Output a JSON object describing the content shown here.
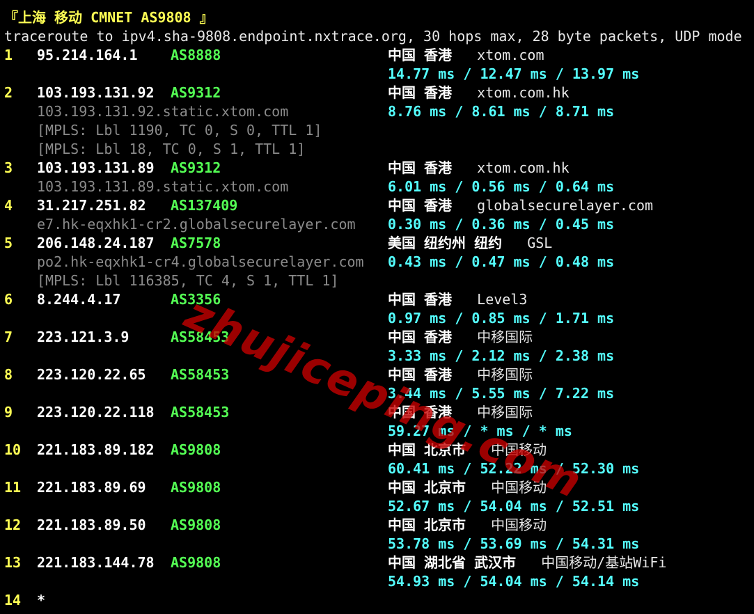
{
  "title": "『上海 移动 CMNET AS9808 』",
  "command": "traceroute to ipv4.sha-9808.endpoint.nxtrace.org, 30 hops max, 28 byte packets, UDP mode",
  "hops": [
    {
      "num": "1",
      "ip": "95.214.164.1",
      "asn": "AS8888",
      "geo": "中国 香港",
      "owner": "xtom.com",
      "rtt": "14.77 ms / 12.47 ms / 13.97 ms",
      "sub": []
    },
    {
      "num": "2",
      "ip": "103.193.131.92",
      "asn": "AS9312",
      "geo": "中国 香港",
      "owner": "xtom.com.hk",
      "rtt": "8.76 ms / 8.61 ms / 8.71 ms",
      "sub": [
        "103.193.131.92.static.xtom.com",
        "[MPLS: Lbl 1190, TC 0, S 0, TTL 1]",
        "[MPLS: Lbl 18, TC 0, S 1, TTL 1]"
      ]
    },
    {
      "num": "3",
      "ip": "103.193.131.89",
      "asn": "AS9312",
      "geo": "中国 香港",
      "owner": "xtom.com.hk",
      "rtt": "6.01 ms / 0.56 ms / 0.64 ms",
      "sub": [
        "103.193.131.89.static.xtom.com"
      ]
    },
    {
      "num": "4",
      "ip": "31.217.251.82",
      "asn": "AS137409",
      "geo": "中国 香港",
      "owner": "globalsecurelayer.com",
      "rtt": "0.30 ms / 0.36 ms / 0.45 ms",
      "sub": [
        "e7.hk-eqxhk1-cr2.globalsecurelayer.com"
      ]
    },
    {
      "num": "5",
      "ip": "206.148.24.187",
      "asn": "AS7578",
      "geo": "美国 纽约州 纽约",
      "owner": "GSL",
      "rtt": "0.43 ms / 0.47 ms / 0.48 ms",
      "sub": [
        "po2.hk-eqxhk1-cr4.globalsecurelayer.com",
        "[MPLS: Lbl 116385, TC 4, S 1, TTL 1]"
      ]
    },
    {
      "num": "6",
      "ip": "8.244.4.17",
      "asn": "AS3356",
      "geo": "中国 香港",
      "owner": "Level3",
      "rtt": "0.97 ms / 0.85 ms / 1.71 ms",
      "sub": []
    },
    {
      "num": "7",
      "ip": "223.121.3.9",
      "asn": "AS58453",
      "geo": "中国 香港",
      "owner": "中移国际",
      "rtt": "3.33 ms / 2.12 ms / 2.38 ms",
      "sub": []
    },
    {
      "num": "8",
      "ip": "223.120.22.65",
      "asn": "AS58453",
      "geo": "中国 香港",
      "owner": "中移国际",
      "rtt": "3.44 ms / 5.55 ms / 7.22 ms",
      "sub": []
    },
    {
      "num": "9",
      "ip": "223.120.22.118",
      "asn": "AS58453",
      "geo": "中国 香港",
      "owner": "中移国际",
      "rtt": "59.27 ms / * ms / * ms",
      "sub": []
    },
    {
      "num": "10",
      "ip": "221.183.89.182",
      "asn": "AS9808",
      "geo": "中国 北京市",
      "owner": "中国移动",
      "rtt": "60.41 ms / 52.22 ms / 52.30 ms",
      "sub": []
    },
    {
      "num": "11",
      "ip": "221.183.89.69",
      "asn": "AS9808",
      "geo": "中国 北京市",
      "owner": "中国移动",
      "rtt": "52.67 ms / 54.04 ms / 52.51 ms",
      "sub": []
    },
    {
      "num": "12",
      "ip": "221.183.89.50",
      "asn": "AS9808",
      "geo": "中国 北京市",
      "owner": "中国移动",
      "rtt": "53.78 ms / 53.69 ms / 54.31 ms",
      "sub": []
    },
    {
      "num": "13",
      "ip": "221.183.144.78",
      "asn": "AS9808",
      "geo": "中国 湖北省 武汉市",
      "owner": "中国移动/基站WiFi",
      "rtt": "54.93 ms / 54.04 ms / 54.14 ms",
      "sub": []
    },
    {
      "num": "14",
      "ip": "*",
      "asn": "",
      "geo": "",
      "owner": "",
      "rtt": "",
      "sub": []
    }
  ],
  "watermark": "zhujiceping.com",
  "colors": {
    "background": "#000000",
    "hop_number": "#ffff54",
    "ip": "#ffffff",
    "asn": "#54ff54",
    "rtt": "#54ffff",
    "sub_text": "#8a8a8a",
    "watermark": "#c80000"
  }
}
